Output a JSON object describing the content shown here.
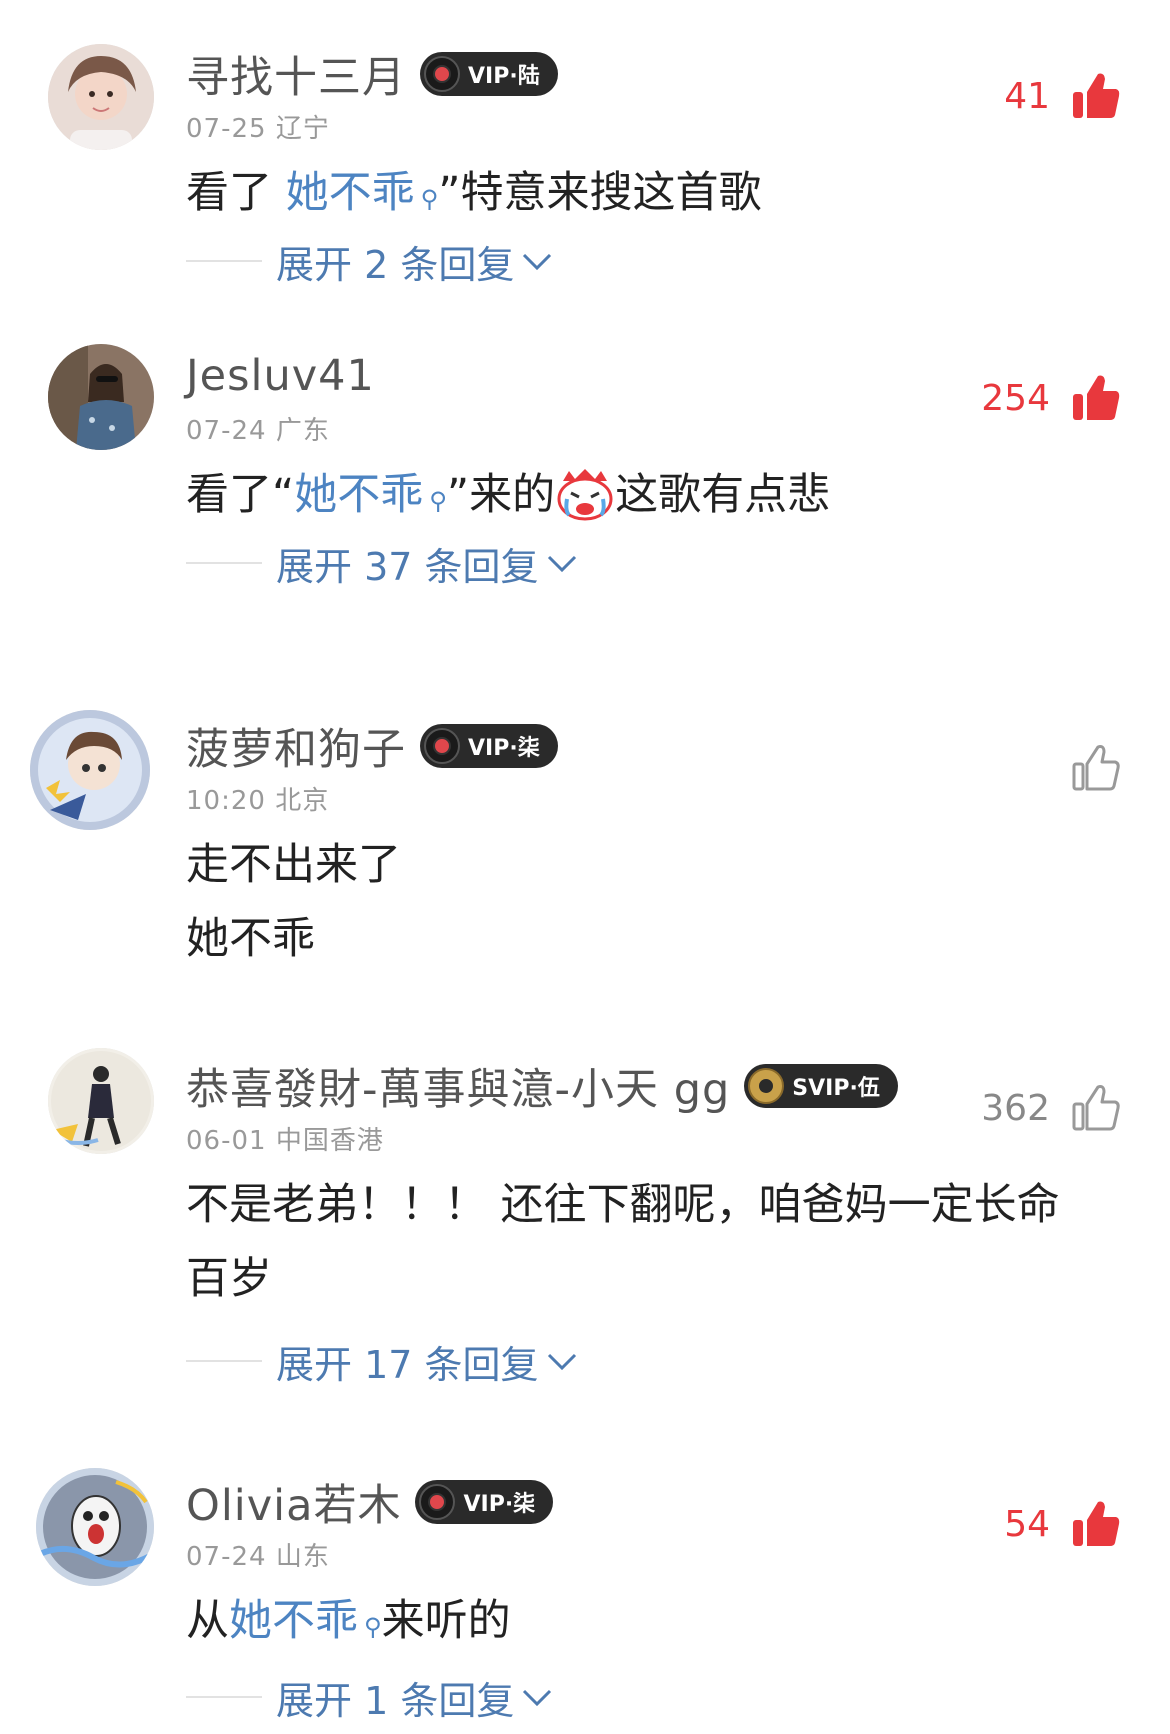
{
  "comments": [
    {
      "name": "寻找十三月",
      "vip": "VIP·陆",
      "date": "07-25",
      "location": "辽宁",
      "likes": "41",
      "liked": true,
      "text_pre": "看了 ",
      "keyword": "她不乖",
      "text_post": "”特意来搜这首歌",
      "expand": "展开 2 条回复"
    },
    {
      "name": "Jesluv41",
      "date": "07-24",
      "location": "广东",
      "likes": "254",
      "liked": true,
      "text_pre": "看了“",
      "keyword": "她不乖",
      "text_mid": "”来的",
      "emoji": "crying-face-emoji",
      "text_post": "这歌有点悲",
      "expand": "展开 37 条回复"
    },
    {
      "name": "菠萝和狗子",
      "vip": "VIP·柒",
      "date": "10:20",
      "location": "北京",
      "likes": "",
      "liked": false,
      "lines": [
        "走不出来了",
        "她不乖"
      ]
    },
    {
      "name": "恭喜發財-萬事與澺-小天 gg",
      "vip": "SVIP·伍",
      "date": "06-01",
      "location": "中国香港",
      "likes": "362",
      "liked": false,
      "lines": [
        "不是老弟！！！ 还往下翻呢，咱爸妈一定长命",
        "百岁"
      ],
      "expand": "展开 17 条回复"
    },
    {
      "name": "Olivia若木",
      "vip": "VIP·柒",
      "date": "07-24",
      "location": "山东",
      "likes": "54",
      "liked": true,
      "text_pre": "从",
      "keyword": "她不乖",
      "text_post": "来听的",
      "expand": "展开 1 条回复"
    }
  ],
  "icons": {
    "search": "search-icon",
    "thumb_filled": "thumb-up-filled-icon",
    "thumb_outline": "thumb-up-outline-icon",
    "chevron": "chevron-down-icon"
  },
  "colors": {
    "like_red": "#e8383d",
    "link_blue": "#4d84c2",
    "expand_blue": "#4d7ab0",
    "meta_gray": "#999999"
  }
}
